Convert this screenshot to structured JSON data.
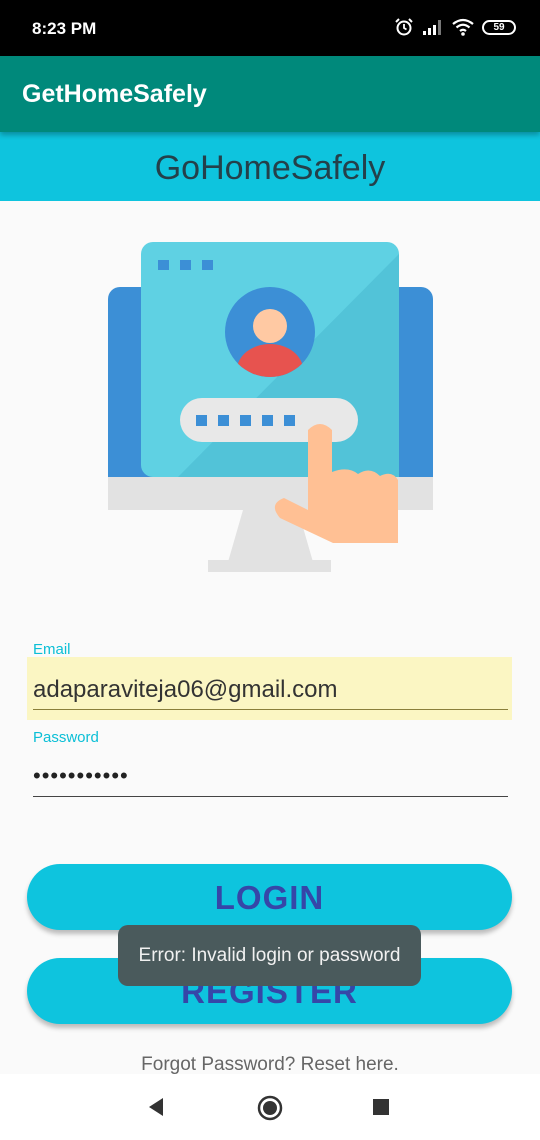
{
  "status_bar": {
    "time": "8:23 PM",
    "battery": "59"
  },
  "app_bar": {
    "title": "GetHomeSafely"
  },
  "banner": {
    "title": "GoHomeSafely"
  },
  "form": {
    "email_label": "Email",
    "email_value": "adaparaviteja06@gmail.com",
    "password_label": "Password",
    "password_value": "•••••••••••"
  },
  "buttons": {
    "login": "LOGIN",
    "register": "REGISTER"
  },
  "toast": {
    "message": "Error: Invalid login or password"
  },
  "links": {
    "forgot_password": "Forgot Password? Reset here."
  },
  "colors": {
    "app_bar": "#00897b",
    "accent": "#0ec4de",
    "button_text": "#3646a8",
    "autofill": "#fbf6c3"
  },
  "icons": [
    "alarm-icon",
    "signal-icon",
    "wifi-icon",
    "battery-icon",
    "back-icon",
    "home-icon",
    "recents-icon"
  ]
}
